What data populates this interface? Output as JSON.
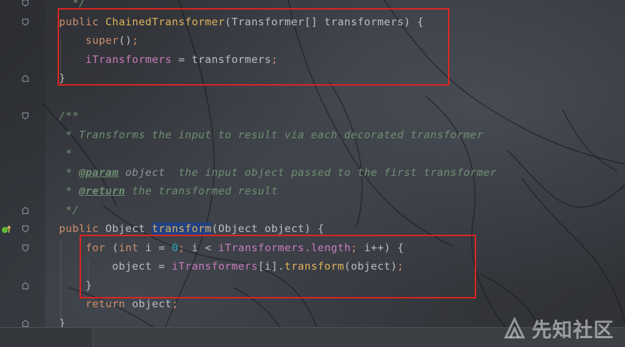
{
  "code": [
    {
      "tokens": [
        {
          "t": "  */",
          "c": "doc"
        }
      ]
    },
    {
      "tokens": [
        {
          "t": "public ",
          "c": "kw"
        },
        {
          "t": "ChainedTransformer",
          "c": "fn"
        },
        {
          "t": "(Transformer[] transformers) {",
          "c": "pn"
        }
      ]
    },
    {
      "tokens": [
        {
          "t": "    ",
          "c": "pn"
        },
        {
          "t": "super",
          "c": "kw"
        },
        {
          "t": "()",
          "c": "pn"
        },
        {
          "t": ";",
          "c": "kw"
        }
      ]
    },
    {
      "tokens": [
        {
          "t": "    ",
          "c": "pn"
        },
        {
          "t": "iTransformers",
          "c": "fld"
        },
        {
          "t": " = transformers",
          "c": "pn"
        },
        {
          "t": ";",
          "c": "kw"
        }
      ]
    },
    {
      "tokens": [
        {
          "t": "}",
          "c": "pn"
        }
      ]
    },
    {
      "tokens": []
    },
    {
      "tokens": [
        {
          "t": "/**",
          "c": "doc"
        }
      ]
    },
    {
      "tokens": [
        {
          "t": " * Transforms the input to result via each decorated transformer",
          "c": "doc"
        }
      ]
    },
    {
      "tokens": [
        {
          "t": " *",
          "c": "doc"
        }
      ]
    },
    {
      "tokens": [
        {
          "t": " * ",
          "c": "doc"
        },
        {
          "t": "@param",
          "c": "tag"
        },
        {
          "t": " ",
          "c": "doc"
        },
        {
          "t": "object",
          "c": "pref"
        },
        {
          "t": "  the input object passed to the first transformer",
          "c": "doc"
        }
      ]
    },
    {
      "tokens": [
        {
          "t": " * ",
          "c": "doc"
        },
        {
          "t": "@return",
          "c": "tag"
        },
        {
          "t": " the transformed result",
          "c": "doc"
        }
      ]
    },
    {
      "tokens": [
        {
          "t": " */",
          "c": "doc"
        }
      ]
    },
    {
      "tokens": [
        {
          "t": "public ",
          "c": "kw"
        },
        {
          "t": "Object ",
          "c": "pn"
        },
        {
          "t": "transform",
          "c": "fn hl"
        },
        {
          "t": "(Object object) {",
          "c": "pn"
        }
      ]
    },
    {
      "tokens": [
        {
          "t": "    ",
          "c": "pn"
        },
        {
          "t": "for ",
          "c": "kw"
        },
        {
          "t": "(",
          "c": "pn"
        },
        {
          "t": "int ",
          "c": "kw"
        },
        {
          "t": "i = ",
          "c": "pn"
        },
        {
          "t": "0",
          "c": "num"
        },
        {
          "t": "; ",
          "c": "kw"
        },
        {
          "t": "i < ",
          "c": "pn"
        },
        {
          "t": "iTransformers",
          "c": "fld"
        },
        {
          "t": ".length",
          "c": "fld"
        },
        {
          "t": "; ",
          "c": "kw"
        },
        {
          "t": "i++) {",
          "c": "pn"
        }
      ]
    },
    {
      "tokens": [
        {
          "t": "        object = ",
          "c": "pn"
        },
        {
          "t": "iTransformers",
          "c": "fld"
        },
        {
          "t": "[i].",
          "c": "pn"
        },
        {
          "t": "transform",
          "c": "fn"
        },
        {
          "t": "(object)",
          "c": "pn"
        },
        {
          "t": ";",
          "c": "kw"
        }
      ]
    },
    {
      "tokens": [
        {
          "t": "    }",
          "c": "pn"
        }
      ]
    },
    {
      "tokens": [
        {
          "t": "    ",
          "c": "pn"
        },
        {
          "t": "return ",
          "c": "kw"
        },
        {
          "t": "object",
          "c": "pn"
        },
        {
          "t": ";",
          "c": "kw"
        }
      ]
    },
    {
      "tokens": [
        {
          "t": "}",
          "c": "pn"
        }
      ]
    }
  ],
  "watermark": {
    "text": "先知社区"
  },
  "icons": {
    "implements": "implements-method-icon",
    "fold": "fold-arrow-icon"
  },
  "colors": {
    "annotation_box": "#e4231f",
    "keyword": "#cf8e6d",
    "method": "#e0b35a",
    "field": "#c77dbb",
    "comment": "#6f8f73"
  }
}
